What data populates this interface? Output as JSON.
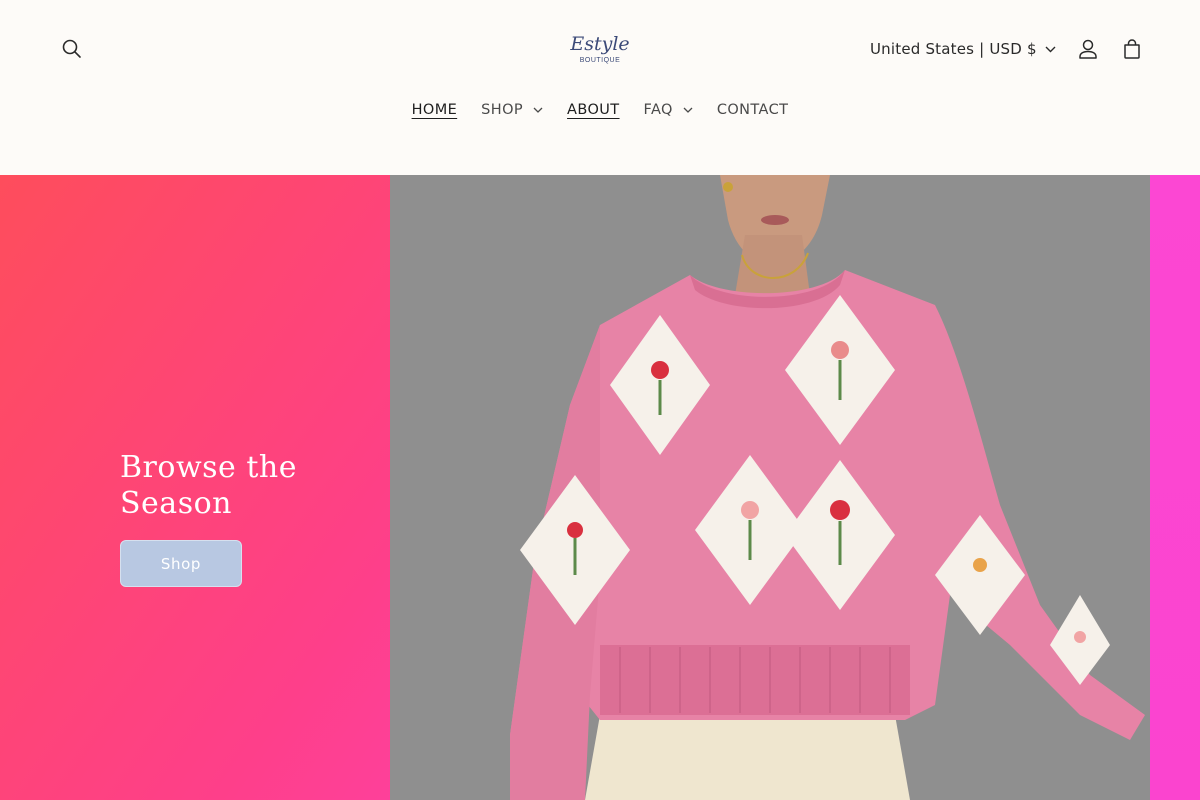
{
  "header": {
    "logo": {
      "script_text": "Estyle",
      "sub_text": "BOUTIQUE"
    },
    "country_selector": {
      "label": "United States | USD $"
    },
    "icons": {
      "search": "search-icon",
      "account": "account-icon",
      "cart": "cart-icon"
    }
  },
  "nav": {
    "items": [
      {
        "label": "HOME",
        "active": true,
        "has_dropdown": false
      },
      {
        "label": "SHOP",
        "active": false,
        "has_dropdown": true
      },
      {
        "label": "ABOUT",
        "active": true,
        "has_dropdown": false
      },
      {
        "label": "FAQ",
        "active": false,
        "has_dropdown": true
      },
      {
        "label": "CONTACT",
        "active": false,
        "has_dropdown": false
      }
    ]
  },
  "hero": {
    "title": "Browse the Season",
    "button_label": "Shop",
    "colors": {
      "gradient_start": "#fe4d5c",
      "gradient_end": "#fb44d4",
      "button_bg": "#b8c8e2"
    }
  }
}
